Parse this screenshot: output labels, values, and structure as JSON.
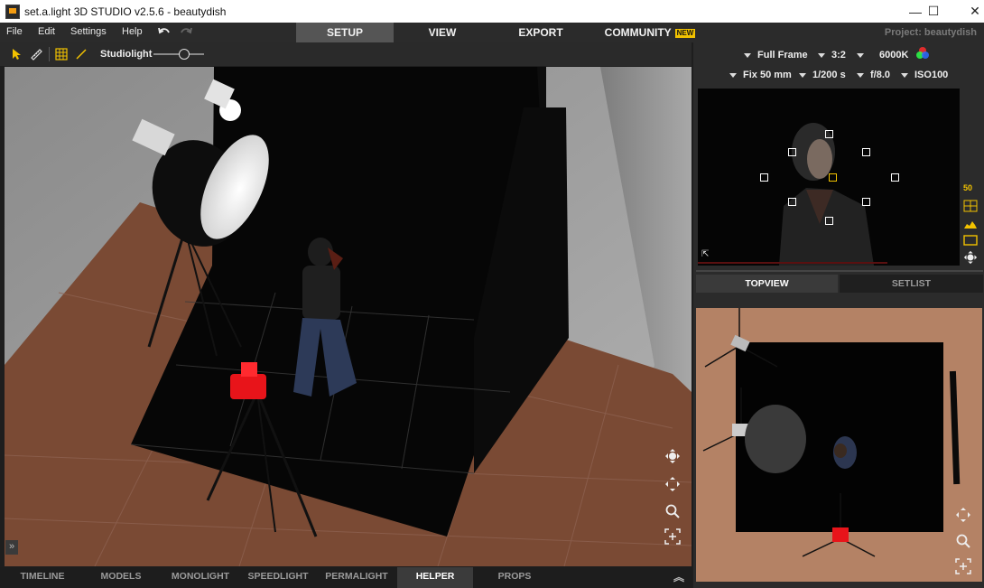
{
  "window": {
    "title": "set.a.light 3D STUDIO v2.5.6 - beautydish",
    "minimize_glyph": "—",
    "maximize_glyph": "☐",
    "close_glyph": "✕"
  },
  "menu": {
    "file": "File",
    "edit": "Edit",
    "settings": "Settings",
    "help": "Help"
  },
  "tabs": {
    "setup": "SETUP",
    "view": "VIEW",
    "export": "EXPORT",
    "community": "COMMUNITY",
    "community_badge": "NEW"
  },
  "project_label": "Project: beautydish",
  "toolbar": {
    "studiolight_label": "Studiolight",
    "studiolight_level": 0.6
  },
  "camera": {
    "format": "Full Frame",
    "aspect": "3:2",
    "white_balance": "6000K",
    "lens": "Fix 50 mm",
    "shutter": "1/200 s",
    "aperture": "f/8.0",
    "iso": "ISO100",
    "zoom_indicator": "50"
  },
  "panel_tabs": {
    "topview": "TOPVIEW",
    "setlist": "SETLIST"
  },
  "bottom_tabs": [
    "TIMELINE",
    "MODELS",
    "MONOLIGHT",
    "SPEEDLIGHT",
    "PERMALIGHT",
    "HELPER",
    "PROPS"
  ],
  "active_bottom_tab": "HELPER",
  "colors": {
    "floor": "#7a4a34",
    "backdrop": "#0a0a0a",
    "accent": "#f2c200",
    "flash": "#e8141a"
  }
}
